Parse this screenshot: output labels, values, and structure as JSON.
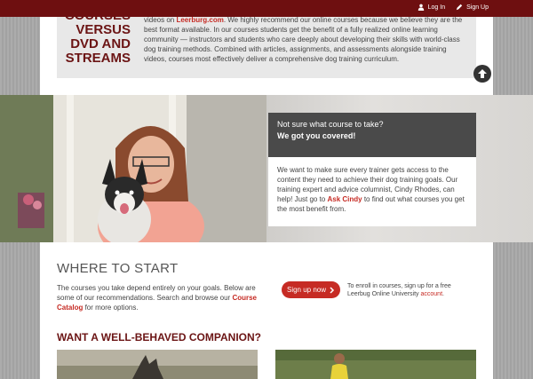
{
  "topbar": {
    "login_label": "Log In",
    "signup_label": "Sign Up"
  },
  "top_section": {
    "heading_lines": [
      "Courses",
      "versus",
      "DVD and",
      "Streams"
    ],
    "para_prefix": "videos on ",
    "para_link": "Leerburg.com",
    "para_rest": ". We highly recommend our online courses because we believe they are the best format available. In our courses students get the benefit of a fully realized online learning community — instructors and students who care deeply about developing their skills with world-class dog training methods. Combined with articles, assignments, and assessments alongside training videos, courses most effectively deliver a comprehensive dog training curriculum."
  },
  "hero": {
    "question": "Not sure what course to take?",
    "answer": "We got you covered!",
    "body_prefix": "We want to make sure every trainer gets access to the content they need to achieve their dog training goals. Our training expert and advice columnist, Cindy Rhodes, can help! Just go to ",
    "body_link": "Ask Cindy",
    "body_suffix": " to find out what courses you get the most benefit from."
  },
  "where_to_start": {
    "title": "WHERE TO START",
    "para_prefix": "The courses you take depend entirely on your goals. Below are some of our recommendations. Search and browse our ",
    "para_link": "Course Catalog",
    "para_suffix": " for more options.",
    "button_label": "Sign up now",
    "enroll_prefix": "To enroll in courses, sign up for a free Leerbug Online University ",
    "enroll_link": "account",
    "enroll_suffix": "."
  },
  "companion": {
    "title": "WANT A WELL-BEHAVED COMPANION?"
  },
  "colors": {
    "topbar": "#6e0f10",
    "accent": "#c62b24",
    "heading": "#6b1414",
    "hero_header": "#4a4a4a"
  },
  "icons": [
    "user-icon",
    "pencil-icon",
    "arrow-up-icon",
    "chevron-right-icon"
  ]
}
